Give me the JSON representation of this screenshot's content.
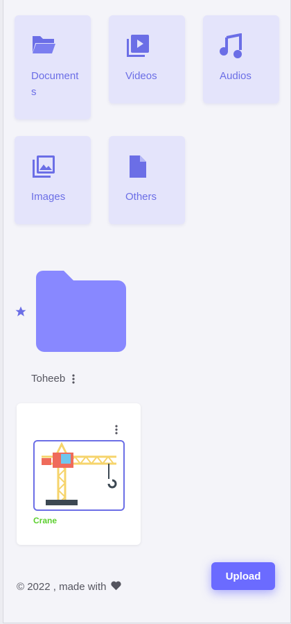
{
  "categories": [
    {
      "label": "Documents",
      "icon": "folder-open-icon"
    },
    {
      "label": "Videos",
      "icon": "video-library-icon"
    },
    {
      "label": "Audios",
      "icon": "music-note-icon"
    },
    {
      "label": "Images",
      "icon": "photo-library-icon"
    },
    {
      "label": "Others",
      "icon": "document-icon"
    }
  ],
  "folder": {
    "name": "Toheeb",
    "starred": true
  },
  "file": {
    "name": "Crane",
    "thumbnail": "crane-illustration"
  },
  "footer": {
    "text": "© 2022 , made with",
    "icon": "heart-icon"
  },
  "upload_label": "Upload",
  "colors": {
    "accent": "#6b6ee6",
    "folder": "#8888ff",
    "file_name": "#5ccf2e",
    "card_bg": "#e4e4fb"
  }
}
